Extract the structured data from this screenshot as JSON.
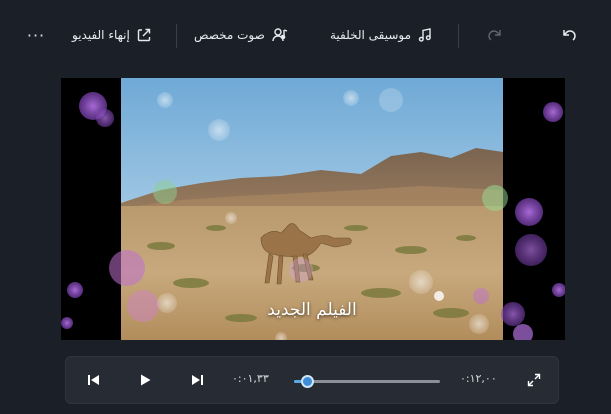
{
  "toolbar": {
    "finish_video_label": "إنهاء الفيديو",
    "custom_audio_label": "صوت مخصص",
    "background_music_label": "موسيقى الخلفية",
    "more_label": "···"
  },
  "preview": {
    "caption": "الفيلم الجديد"
  },
  "playback": {
    "current_time": "٠:٠١,٣٣",
    "total_time": "٠:١٢,٠٠",
    "progress": 0.09
  },
  "colors": {
    "accent": "#3d8ed6",
    "background": "#1b1f27"
  }
}
